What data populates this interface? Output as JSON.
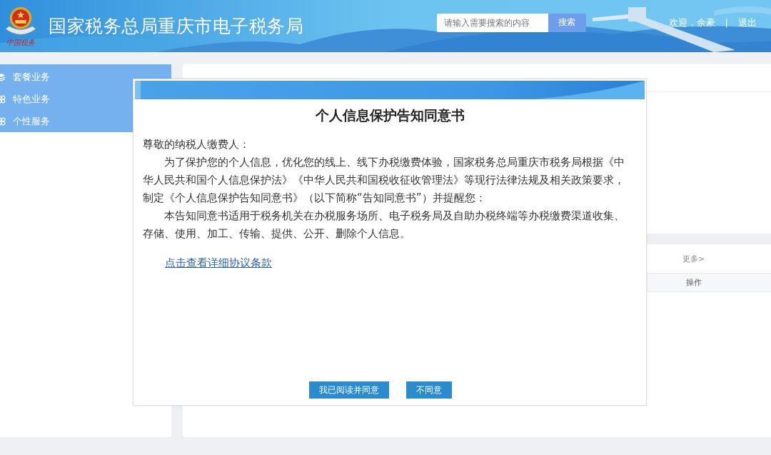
{
  "header": {
    "title": "国家税务总局重庆市电子税务局",
    "logo_caption": "中国税务",
    "search": {
      "placeholder": "请输入需要搜索的内容",
      "button": "搜索"
    },
    "greeting": "欢迎，余豪",
    "separator": "|",
    "logout": "退出"
  },
  "sidebar": {
    "items": [
      {
        "label": "套餐业务",
        "kind": "layers"
      },
      {
        "label": "特色业务",
        "kind": "clover"
      },
      {
        "label": "个性服务",
        "kind": "clover"
      }
    ]
  },
  "panel": {
    "more_link": "更多>",
    "column_header": "操作"
  },
  "dialog": {
    "title": "个人信息保护告知同意书",
    "salutation": "尊敬的纳税人缴费人：",
    "paragraphs": [
      "为了保护您的个人信息，优化您的线上、线下办税缴费体验，国家税务总局重庆市税务局根据《中华人民共和国个人信息保护法》《中华人民共和国税收征收管理法》等现行法律法规及相关政策要求，制定《个人信息保护告知同意书》（以下简称“告知同意书”）并提醒您：",
      "本告知同意书适用于税务机关在办税服务场所、电子税务局及自助办税终端等办税缴费渠道收集、存储、使用、加工、传输、提供、公开、删除个人信息。"
    ],
    "link": "点击查看详细协议条款",
    "buttons": [
      "我已阅读并同意",
      "不同意"
    ]
  }
}
